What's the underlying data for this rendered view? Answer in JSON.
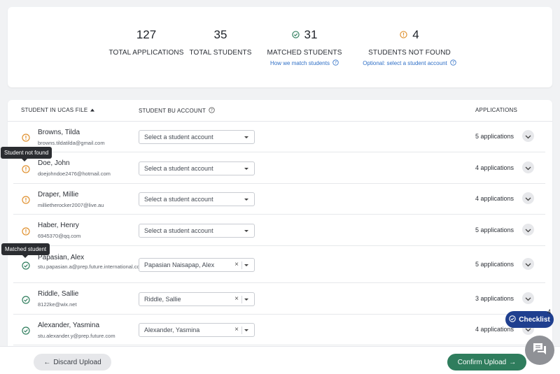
{
  "summary": {
    "total_applications": {
      "value": "127",
      "label": "TOTAL APPLICATIONS"
    },
    "total_students": {
      "value": "35",
      "label": "TOTAL STUDENTS"
    },
    "matched_students": {
      "value": "31",
      "label": "MATCHED STUDENTS",
      "link": "How we match students"
    },
    "students_not_found": {
      "value": "4",
      "label": "STUDENTS NOT FOUND",
      "link": "Optional: select a student account"
    }
  },
  "table": {
    "headers": {
      "student": "STUDENT IN UCAS FILE",
      "account": "STUDENT  BU ACCOUNT",
      "applications": "APPLICATIONS"
    },
    "rows": [
      {
        "status": "not-found",
        "name": "Browns, Tilda",
        "email": "browns.tildatilda@gmail.com",
        "account": "Select a student account",
        "applications": "5 applications"
      },
      {
        "status": "not-found",
        "name": "Doe, John",
        "email": "doejohndoe2476@hotmail.com",
        "account": "Select a student account",
        "applications": "4 applications"
      },
      {
        "status": "not-found",
        "name": "Draper, Millie",
        "email": "millietherocker2007@live.au",
        "account": "Select a student account",
        "applications": "4 applications"
      },
      {
        "status": "not-found",
        "name": "Haber, Henry",
        "email": "6945370@qq.com",
        "account": "Select a student account",
        "applications": "5 applications"
      },
      {
        "status": "matched",
        "name": "Papasian, Alex",
        "email": "stu.papasian.a@prep.future.international.com",
        "account": "Papasian Naisapap, Alex",
        "applications": "5 applications"
      },
      {
        "status": "matched",
        "name": "Riddle, Sallie",
        "email": "8122ke@wix.net",
        "account": "Riddle, Sallie",
        "applications": "3 applications"
      },
      {
        "status": "matched",
        "name": "Alexander, Yasmina",
        "email": "stu.alexander.y@prep.future.com",
        "account": "Alexander, Yasmina",
        "applications": "4 applications"
      }
    ]
  },
  "tooltips": {
    "not_found": "Student not found",
    "matched": "Matched student"
  },
  "footer": {
    "discard": "Discard Upload",
    "confirm": "Confirm Upload"
  },
  "checklist": {
    "label": "Checklist",
    "count": "4"
  },
  "colors": {
    "warning": "#e0912f",
    "success": "#2f7d5d",
    "link": "#2f6fc6",
    "checklist": "#1f3f8f"
  }
}
